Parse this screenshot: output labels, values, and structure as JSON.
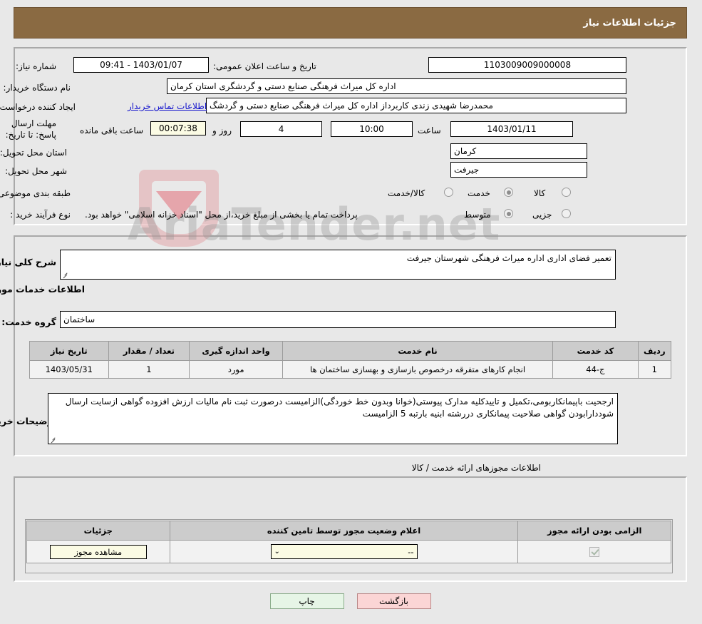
{
  "header": {
    "title": "جزئیات اطلاعات نیاز"
  },
  "need_info": {
    "need_number_label": "شماره نیاز:",
    "need_number_value": "1103009009000008",
    "announce_datetime_label": "تاریخ و ساعت اعلان عمومی:",
    "announce_datetime_value": "1403/01/07 - 09:41",
    "buyer_org_label": "نام دستگاه خریدار:",
    "buyer_org_value": "اداره کل میراث فرهنگی  صنایع دستی و گردشگری استان کرمان",
    "requester_label": "ایجاد کننده درخواست:",
    "requester_value": "محمدرضا شهیدی زندی کاربرداز اداره کل میراث فرهنگی  صنایع دستی و گردشگ",
    "contact_link": "اطلاعات تماس خریدار",
    "deadline_label": "مهلت ارسال پاسخ: تا تاریخ:",
    "deadline_date": "1403/01/11",
    "deadline_hour_label": "ساعت",
    "deadline_time": "10:00",
    "remaining_days": "4",
    "remaining_days_label": "روز و",
    "remaining_clock": "00:07:38",
    "remaining_clock_label": "ساعت باقی مانده",
    "province_label": "استان محل تحویل:",
    "province_value": "کرمان",
    "city_label": "شهر محل تحویل:",
    "city_value": "جیرفت",
    "category_label": "طبقه بندی موضوعی:",
    "category_options": [
      {
        "label": "کالا",
        "selected": false
      },
      {
        "label": "خدمت",
        "selected": true
      },
      {
        "label": "کالا/خدمت",
        "selected": false
      }
    ],
    "process_label": "نوع فرآیند خرید :",
    "process_options": [
      {
        "label": "جزیی",
        "selected": false
      },
      {
        "label": "متوسط",
        "selected": true
      }
    ],
    "treasury_note": "پرداخت تمام یا بخشی از مبلغ خرید،از محل \"اسناد خزانه اسلامی\" خواهد بود."
  },
  "description": {
    "general_label": "شرح کلی نیاز:",
    "general_value": "تعمیر فضای اداری اداره میراث فرهنگی شهرستان جیرفت",
    "services_caption": "اطلاعات خدمات مورد نیاز",
    "service_group_label": "گروه خدمت:",
    "service_group_value": "ساختمان",
    "buyer_notes_label": "توضیحات خریدار:",
    "buyer_notes_value": "ارجحیت باپیمانکاربومی،تکمیل و تاییدکلیه مدارک پیوستی(خوانا وبدون خط خوردگی)الزامیست درصورت ثبت نام مالیات ارزش افزوده گواهی ازسایت ارسال شوددارابودن گواهی صلاحیت پیمانکاری دررشته ابنیه بارتبه 5 الزامیست"
  },
  "services_table": {
    "headers": [
      "ردیف",
      "کد خدمت",
      "نام خدمت",
      "واحد اندازه گیری",
      "تعداد / مقدار",
      "تاریخ نیاز"
    ],
    "rows": [
      {
        "row": "1",
        "code": "ج-44",
        "name": "انجام کارهای متفرقه درخصوص بازسازی و بهسازی ساختمان ها",
        "unit": "مورد",
        "quantity": "1",
        "need_date": "1403/05/31"
      }
    ]
  },
  "licenses": {
    "caption": "اطلاعات مجوزهای ارائه خدمت / کالا",
    "headers": [
      "الزامی بودن ارائه مجوز",
      "اعلام وضعیت مجوز توسط تامین کننده",
      "جزئیات"
    ],
    "rows": [
      {
        "required": true,
        "status_value": "--",
        "status_arrow": "⌄",
        "details_button": "مشاهده مجوز"
      }
    ]
  },
  "footer": {
    "print_label": "چاپ",
    "back_label": "بازگشت"
  },
  "watermark": {
    "text": "AriaTender.net"
  }
}
